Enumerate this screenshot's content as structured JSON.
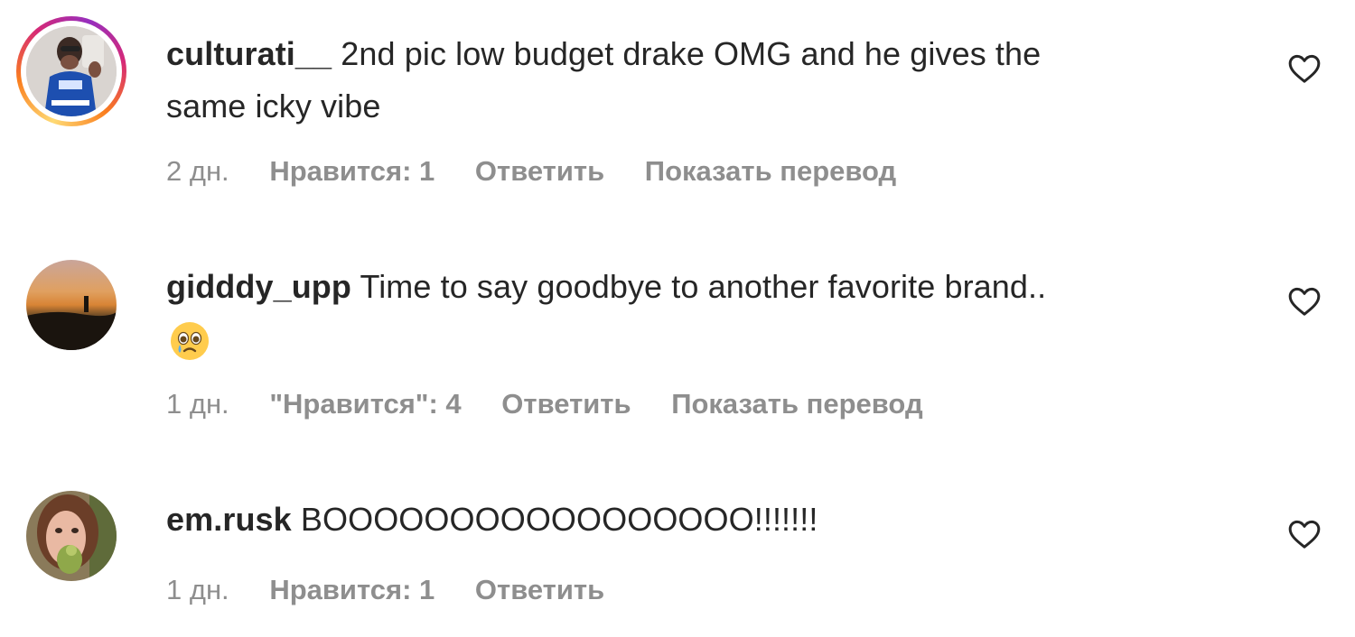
{
  "comments": [
    {
      "username": "culturati__",
      "text": "2nd pic low budget drake OMG and he gives the",
      "text_line2": "same icky vibe",
      "time": "2 дн.",
      "likes": "Нравится: 1",
      "reply": "Ответить",
      "translate": "Показать перевод",
      "has_story_ring": true
    },
    {
      "username": "gidddy_upp",
      "text": "Time to say goodbye to another favorite brand..",
      "emoji": "crying-face-emoji",
      "time": "1 дн.",
      "likes": "\"Нравится\": 4",
      "reply": "Ответить",
      "translate": "Показать перевод",
      "has_story_ring": false
    },
    {
      "username": "em.rusk",
      "text": "BOOOOOOOOOOOOOOOOO!!!!!!!",
      "time": "1 дн.",
      "likes": "Нравится: 1",
      "reply": "Ответить",
      "has_story_ring": false
    }
  ],
  "icons": {
    "like": "heart-outline-icon"
  },
  "colors": {
    "text": "#262626",
    "meta": "#8e8e8e"
  }
}
